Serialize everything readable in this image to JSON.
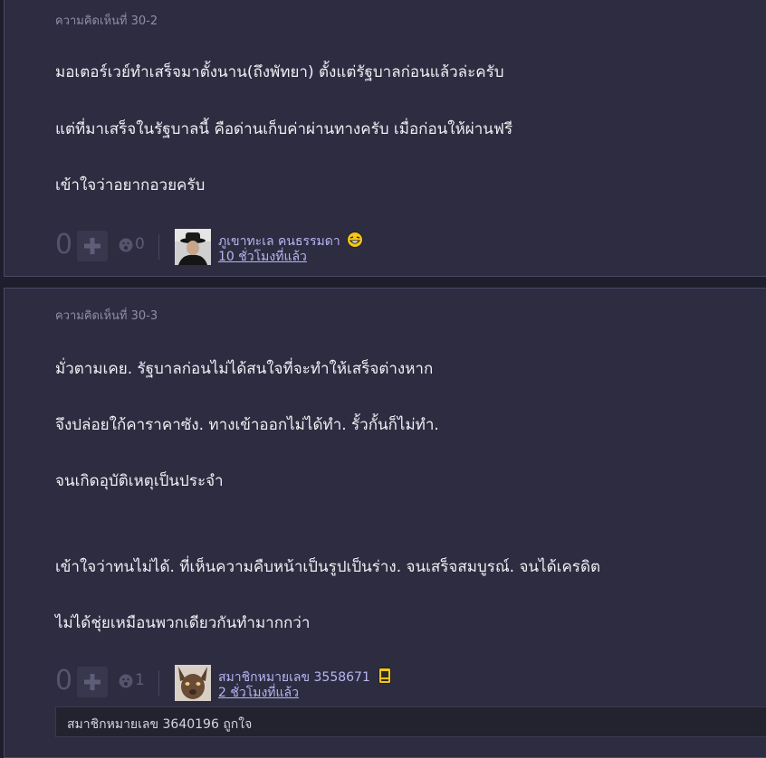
{
  "comments": [
    {
      "label": "ความคิดเห็นที่ 30-2",
      "lines": [
        "มอเตอร์เวย์ทำเสร็จมาตั้งนาน(ถึงพัทยา) ตั้งแต่รัฐบาลก่อนแล้วล่ะครับ",
        "แต่ที่มาเสร็จในรัฐบาลนี้  คือด่านเก็บค่าผ่านทางครับ  เมื่อก่อนให้ผ่านฟรี",
        "เข้าใจว่าอยากอวยครับ"
      ],
      "score": "0",
      "emotion_count": "0",
      "user_name": "ภูเขาทะเล คนธรรมดา",
      "time": "10 ชั่วโมงที่แล้ว",
      "badge_icon": "laughing-emoji-icon"
    },
    {
      "label": "ความคิดเห็นที่ 30-3",
      "lines": [
        "มั่วตามเคย.    รัฐบาลก่อนไม่ได้สนใจที่จะทำให้เสร็จต่างหาก",
        "จึงปล่อยใก้คาราคาซัง.   ทางเข้าออกไม่ได้ทำ.    รั้วกั้นก็ไม่ทำ.",
        "จนเกิดอุบัติเหตุเป็นประจำ",
        "เข้าใจว่าทนไม่ได้.   ที่เห็นความคืบหน้าเป็นรูปเป็นร่าง.   จนเสร็จสมบูรณ์. จนได้เครดิต",
        "ไม่ได้ชุ่ยเหมือนพวกเดียวกันทำมากกว่า"
      ],
      "score": "0",
      "emotion_count": "1",
      "user_name": "สมาชิกหมายเลข 3558671",
      "time": "2 ชั่วโมงที่แล้ว",
      "badge_icon": "member-badge-icon",
      "liked_by": "สมาชิกหมายเลข 3640196 ถูกใจ"
    }
  ]
}
